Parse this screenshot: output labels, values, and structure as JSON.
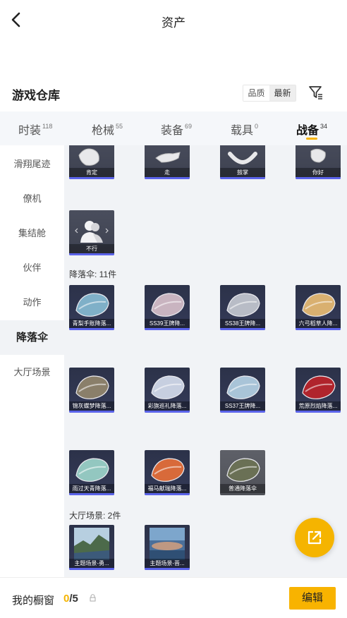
{
  "header": {
    "title": "资产"
  },
  "warehouse": {
    "title": "游戏仓库",
    "sort_options": [
      {
        "label": "品质"
      },
      {
        "label": "最新"
      }
    ]
  },
  "tabs": [
    {
      "label": "时装",
      "count": "118"
    },
    {
      "label": "枪械",
      "count": "55"
    },
    {
      "label": "装备",
      "count": "69"
    },
    {
      "label": "载具",
      "count": "0"
    },
    {
      "label": "战备",
      "count": "34"
    }
  ],
  "sidebar": {
    "items": [
      {
        "label": "滑翔尾迹"
      },
      {
        "label": "僚机"
      },
      {
        "label": "集结舱"
      },
      {
        "label": "伙伴"
      },
      {
        "label": "动作"
      },
      {
        "label": "降落伞"
      },
      {
        "label": "大厅场景"
      }
    ],
    "active": "降落伞"
  },
  "emotes": {
    "items": [
      {
        "label": "肯定"
      },
      {
        "label": "走"
      },
      {
        "label": "鼓掌"
      },
      {
        "label": "你好"
      },
      {
        "label": "不行"
      }
    ]
  },
  "parachutes": {
    "heading": "降落伞: 11件",
    "items": [
      {
        "label": "青梨手账降落...",
        "color": "#7fb0c8"
      },
      {
        "label": "SS39王牌降...",
        "color": "#c9b4c0"
      },
      {
        "label": "SS38王牌降...",
        "color": "#b8bcc6"
      },
      {
        "label": "六弓稻草人降...",
        "color": "#d9b070"
      },
      {
        "label": "锦灰蝶梦降落...",
        "color": "#8a7f6a"
      },
      {
        "label": "彩旗巡礼降落...",
        "color": "#c7cfe0"
      },
      {
        "label": "SS37王牌降...",
        "color": "#a9c4d8"
      },
      {
        "label": "荒原烈焰降落...",
        "color": "#b0242c"
      },
      {
        "label": "雨过天青降落...",
        "color": "#93c7c0"
      },
      {
        "label": "福马献瑞降落...",
        "color": "#d86a3a"
      },
      {
        "label": "普通降落伞",
        "color": "#6a7055"
      }
    ]
  },
  "lobby_scenes": {
    "heading": "大厅场景: 2件",
    "items": [
      {
        "label": "主题场景-勇..."
      },
      {
        "label": "主题场景-晋..."
      }
    ]
  },
  "bottom": {
    "title": "我的橱窗",
    "current": "0",
    "total": "/5",
    "edit_label": "编辑"
  },
  "colors": {
    "accent": "#f8b300",
    "card_bar": "#5b63ea",
    "panel_bg": "#f1f3f6"
  }
}
